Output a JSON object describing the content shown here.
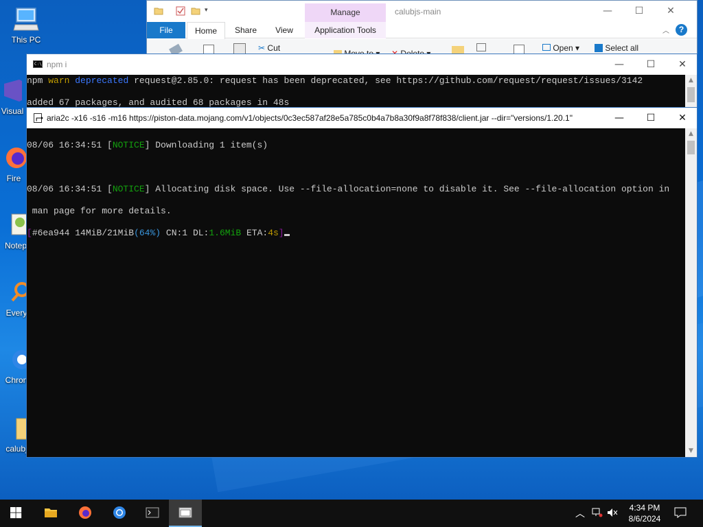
{
  "desktop": {
    "icons": [
      {
        "label": "This PC"
      },
      {
        "label": "Visual"
      },
      {
        "label": "Fire"
      },
      {
        "label": "Notep"
      },
      {
        "label": "Every"
      },
      {
        "label": "Chron"
      },
      {
        "label": "calubj"
      }
    ]
  },
  "explorer": {
    "title": "calubjs-main",
    "manage_tab": "Manage",
    "tabs": [
      "File",
      "Home",
      "Share",
      "View",
      "Application Tools"
    ],
    "ribbon": {
      "cut": "Cut",
      "move_to": "Move to",
      "delete": "Delete",
      "open": "Open",
      "select_all": "Select all"
    },
    "minimize": "—",
    "maximize": "☐",
    "close": "✕",
    "help": "?"
  },
  "console_npm": {
    "title": "npm i",
    "line1_prefix": "npm",
    "line1_warn": "warn",
    "line1_deprecated": "deprecated",
    "line1_rest": "request@2.85.0: request has been deprecated, see https://github.com/request/request/issues/3142",
    "line2": "added 67 packages, and audited 68 packages in 48s"
  },
  "console_aria": {
    "title": "aria2c  -x16 -s16 -m16 https://piston-data.mojang.com/v1/objects/0c3ec587af28e5a785c0b4a7b8a30f9a8f78f838/client.jar --dir=\"versions/1.20.1\"",
    "log1_time": "08/06 16:34:51",
    "log1_level": "NOTICE",
    "log1_msg": "Downloading 1 item(s)",
    "log2_time": "08/06 16:34:51",
    "log2_level": "NOTICE",
    "log2_msg": "Allocating disk space. Use --file-allocation=none to disable it. See --file-allocation option in",
    "log2_cont": " man page for more details.",
    "progress_id": "#6ea944",
    "progress_size": "14MiB/21MiB",
    "progress_pct": "64%",
    "progress_cn": "CN:1",
    "progress_dl_label": "DL:",
    "progress_dl": "1.6MiB",
    "progress_eta_label": "ETA:",
    "progress_eta": "4s"
  },
  "taskbar": {
    "time": "4:34 PM",
    "date": "8/6/2024"
  },
  "colors": {
    "file_tab": "#1979ca",
    "manage_tab": "#efd7f7",
    "console_bg": "#0c0c0c",
    "notice_green": "#13a10e",
    "warn_yellow": "#c19c00",
    "taskbar": "#101010"
  }
}
